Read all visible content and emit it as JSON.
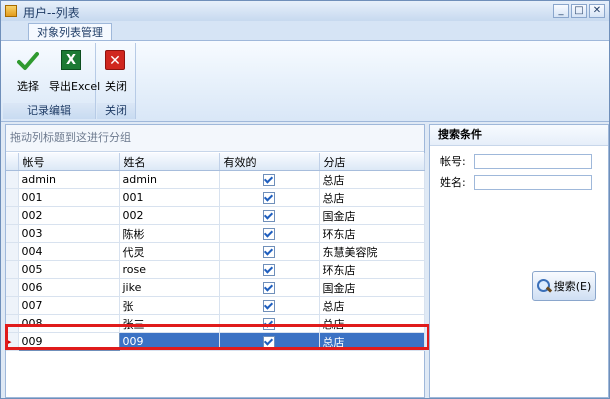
{
  "window": {
    "title": "用户--列表",
    "buttons": [
      "_",
      "□",
      "✕"
    ]
  },
  "ribbon": {
    "tab": "对象列表管理",
    "groups": [
      {
        "label": "记录编辑",
        "buttons": [
          {
            "label": "选择",
            "icon": "check-icon"
          },
          {
            "label": "导出Excel",
            "icon": "excel-icon"
          }
        ]
      },
      {
        "label": "关闭",
        "buttons": [
          {
            "label": "关闭",
            "icon": "close-icon"
          }
        ]
      }
    ]
  },
  "grid": {
    "group_hint": "拖动列标题到这进行分组",
    "columns": [
      "帐号",
      "姓名",
      "有效的",
      "分店"
    ],
    "rows": [
      {
        "account": "admin",
        "name": "admin",
        "valid": true,
        "branch": "总店"
      },
      {
        "account": "001",
        "name": "001",
        "valid": true,
        "branch": "总店"
      },
      {
        "account": "002",
        "name": "002",
        "valid": true,
        "branch": "国金店"
      },
      {
        "account": "003",
        "name": "陈彬",
        "valid": true,
        "branch": "环东店"
      },
      {
        "account": "004",
        "name": "代灵",
        "valid": true,
        "branch": "东慧美容院"
      },
      {
        "account": "005",
        "name": "rose",
        "valid": true,
        "branch": "环东店"
      },
      {
        "account": "006",
        "name": "jike",
        "valid": true,
        "branch": "国金店"
      },
      {
        "account": "007",
        "name": "张",
        "valid": true,
        "branch": "总店"
      },
      {
        "account": "008",
        "name": "张三",
        "valid": true,
        "branch": "总店"
      },
      {
        "account": "009",
        "name": "009",
        "valid": true,
        "branch": "总店"
      }
    ],
    "selected_row_index": 9,
    "row_indicator": "▸"
  },
  "search": {
    "title": "搜索条件",
    "account_label": "帐号:",
    "name_label": "姓名:",
    "account_value": "",
    "name_value": "",
    "button_label": "搜索(E)"
  }
}
